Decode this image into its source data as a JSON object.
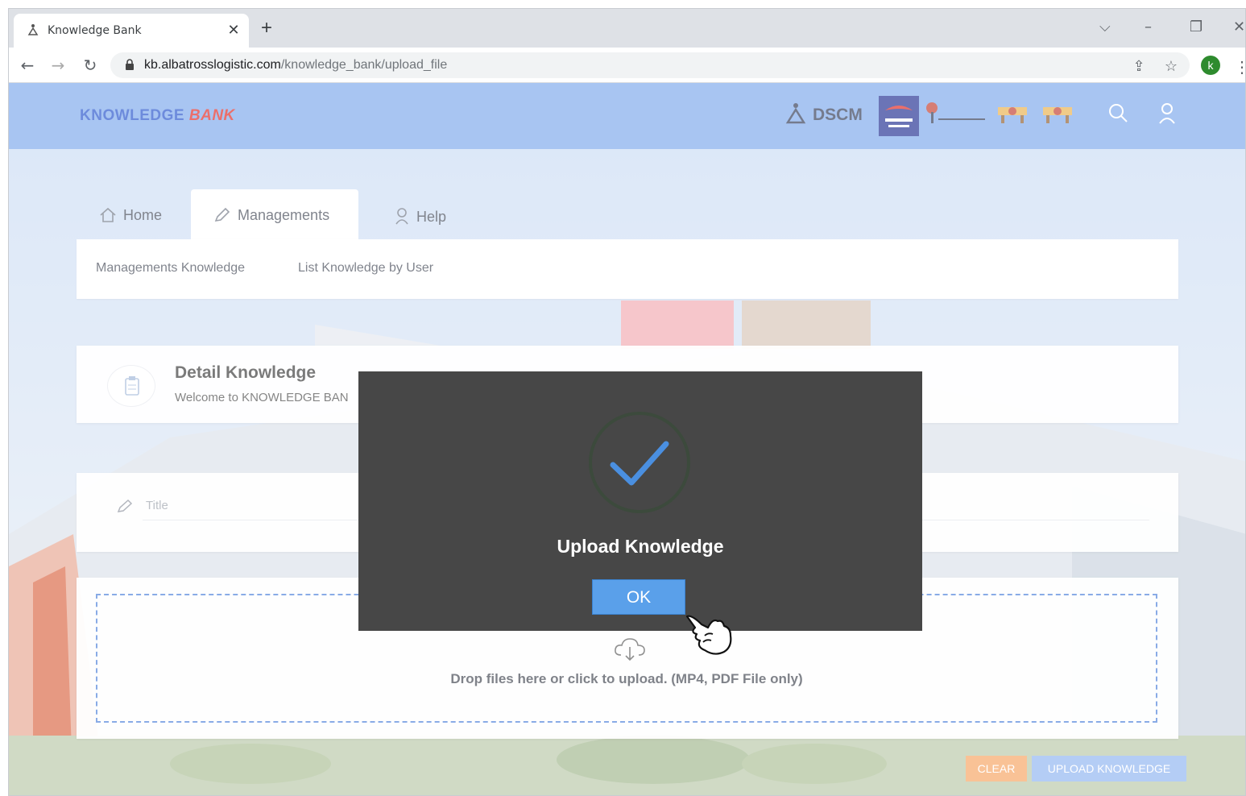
{
  "browser": {
    "tab_title": "Knowledge Bank",
    "new_tab": "+",
    "url_host": "kb.albatrosslogistic.com",
    "url_path": "/knowledge_bank/upload_file",
    "profile_initial": "k"
  },
  "header": {
    "logo_part1": "KNOWLEDGE ",
    "logo_part2": "BANK",
    "partner_dscm": "DSCM"
  },
  "nav": {
    "tabs": [
      {
        "label": "Home",
        "icon": "home-icon"
      },
      {
        "label": "Managements",
        "icon": "pencil-icon",
        "active": true
      },
      {
        "label": "Help",
        "icon": "help-icon"
      }
    ],
    "sub_items": [
      "Managements Knowledge",
      "List Knowledge by User"
    ]
  },
  "detail": {
    "title": "Detail Knowledge",
    "subtitle": "Welcome to KNOWLEDGE BAN"
  },
  "form": {
    "title_placeholder": "Title",
    "drop_text": "Drop files here or click to upload. (MP4, PDF File only)"
  },
  "actions": {
    "clear": "CLEAR",
    "upload": "UPLOAD KNOWLEDGE"
  },
  "dialog": {
    "title": "Upload Knowledge",
    "ok": "OK"
  },
  "colors": {
    "header": "#7aa7ec",
    "dialog_bg": "#474747",
    "ok_button": "#5aa0ea",
    "check": "#4a8fe0",
    "clear_button": "#f6a15e",
    "upload_button": "#8db2f0"
  }
}
